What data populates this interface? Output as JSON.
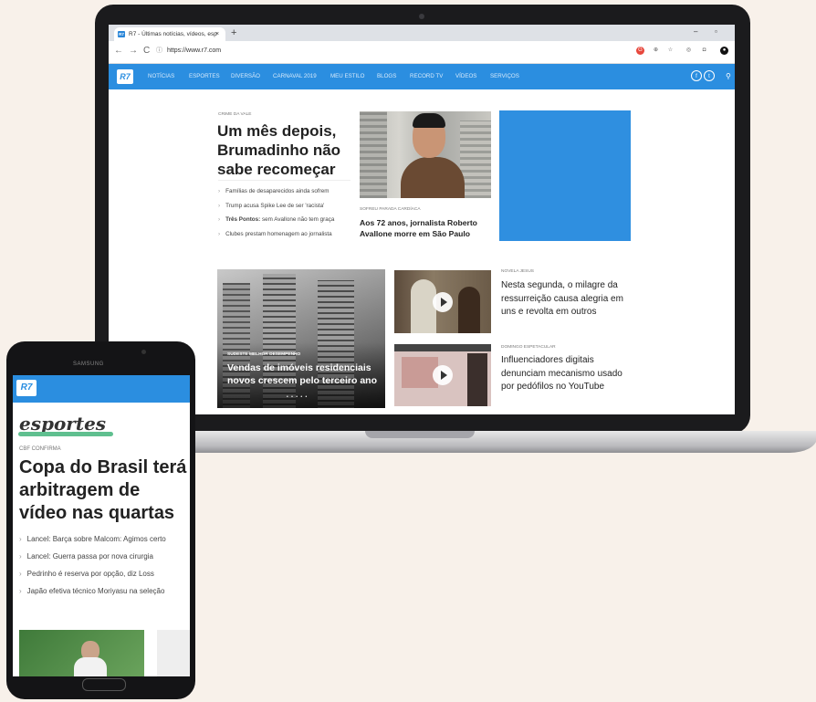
{
  "browser": {
    "tab_title": "R7 - Últimas notícias, vídeos, esp",
    "tab_favicon": "R7",
    "url": "https://www.r7.com",
    "win_minimize": "–",
    "win_maximize": "▫"
  },
  "site": {
    "logo": "R7",
    "nav": [
      "NOTÍCIAS",
      "ESPORTES",
      "DIVERSÃO",
      "CARNAVAL 2019",
      "MEU ESTILO",
      "BLOGS",
      "RECORD TV",
      "VÍDEOS",
      "SERVIÇOS"
    ],
    "social": [
      "f",
      "t"
    ],
    "accent": "#2b8ee0"
  },
  "main_story": {
    "kicker": "CRIME DA VALE",
    "headline": "Um mês depois, Brumadinho não sabe recomeçar",
    "bullets": [
      {
        "bold": "",
        "text": "Famílias de desaparecidos ainda sofrem"
      },
      {
        "bold": "",
        "text": "Trump acusa Spike Lee de ser 'racista'"
      },
      {
        "bold": "Três Pontos:",
        "text": " sem Avallone não tem graça"
      },
      {
        "bold": "",
        "text": "Clubes prestam homenagem ao jornalista"
      }
    ]
  },
  "story2": {
    "kicker": "SOFREU PARADA CARDÍACA",
    "headline": "Aos 72 anos, jornalista Roberto Avallone morre em São Paulo"
  },
  "story3": {
    "kicker": "SUDESTE MELHOR DESEMPENHO",
    "headline": "Vendas de imóveis residenciais novos crescem pelo terceiro ano",
    "dots": "• • • • •"
  },
  "story4": {
    "kicker": "NOVELA JESUS",
    "headline": "Nesta segunda, o milagre da ressurreição causa alegria em uns e revolta em outros"
  },
  "story5": {
    "kicker": "DOMINGO ESPETACULAR",
    "headline": "Influenciadores digitais denunciam mecanismo usado por pedófilos no YouTube"
  },
  "phone": {
    "brand": "SAMSUNG",
    "logo": "R7",
    "section": "esportes",
    "kicker": "CBF CONFIRMA",
    "headline": "Copa do Brasil terá arbitragem de vídeo nas quartas",
    "bullets": [
      "Lancel: Barça sobre Malcom: Agimos certo",
      "Lancel: Guerra passa por nova cirurgia",
      "Pedrinho é reserva por opção, diz Loss",
      "Japão efetiva técnico Moriyasu na seleção"
    ]
  }
}
